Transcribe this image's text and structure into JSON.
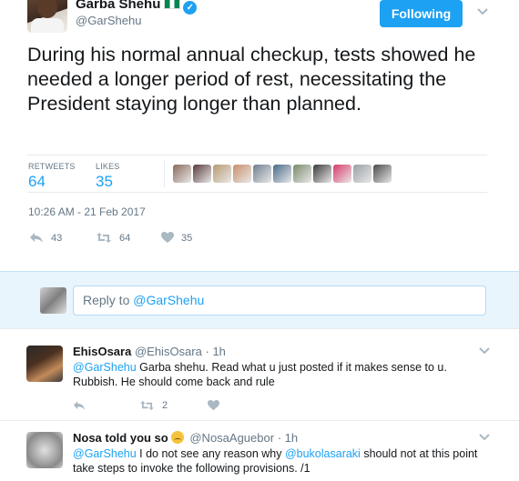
{
  "tweet": {
    "author_name": "Garba Shehu",
    "author_handle": "@GarShehu",
    "follow_label": "Following",
    "text": "During his normal annual checkup, tests showed he needed a longer period of rest, necessitating the President staying longer than planned.",
    "retweets_label": "RETWEETS",
    "retweets_count": "64",
    "likes_label": "LIKES",
    "likes_count": "35",
    "timestamp": "10:26 AM - 21 Feb 2017",
    "actions": {
      "reply_count": "43",
      "retweet_count": "64",
      "like_count": "35"
    },
    "liker_colors": [
      "#8a6a5a",
      "#5a3a3a",
      "#b89a70",
      "#c98f6a",
      "#6f7f8f",
      "#4a6a8a",
      "#7a8a6a",
      "#3a3a3a",
      "#d83a6a",
      "#9aa0a6",
      "#4a4a4a"
    ]
  },
  "reply_box": {
    "prefix": "Reply to ",
    "mention": "@GarShehu"
  },
  "replies": [
    {
      "name": "EhisOsara",
      "handle": "@EhisOsara",
      "time": "1h",
      "mention": "@GarShehu",
      "text": " Garba shehu. Read what u just posted if it makes sense to u. Rubbish. He should come back and rule",
      "retweet_count": "2"
    },
    {
      "name": "Nosa told you so",
      "handle": "@NosaAguebor",
      "time": "1h",
      "mention": "@GarShehu",
      "text_a": " I do not see any reason why ",
      "mention2": "@bukolasaraki",
      "text_b": " should not at this point take steps to invoke the following provisions. /1"
    }
  ],
  "colors": {
    "accent": "#1da1f2",
    "muted": "#657786",
    "reply_bg": "#e8f5fd"
  }
}
